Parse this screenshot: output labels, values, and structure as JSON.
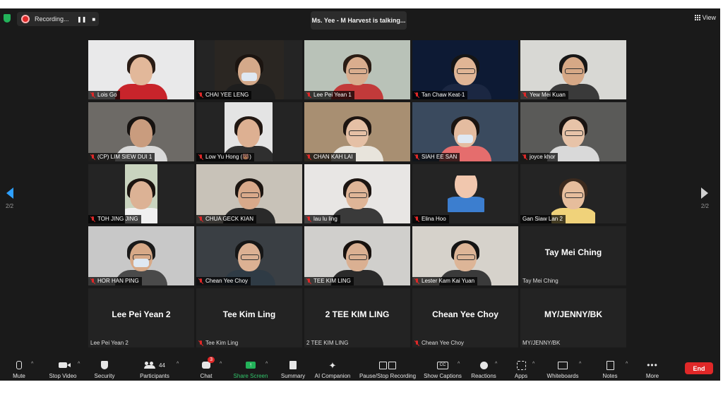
{
  "topbar": {
    "recording_label": "Recording...",
    "pause_icon": "pause-icon",
    "stop_icon": "stop-icon",
    "talking_text": "Ms. Yee - M Harvest is talking...",
    "view_label": "View"
  },
  "pager": {
    "left": "2/2",
    "right": "2/2"
  },
  "participants": [
    {
      "name": "Lois Go",
      "muted": true
    },
    {
      "name": "CHAI YEE LENG",
      "muted": true
    },
    {
      "name": "Lee Pei Yean 1",
      "muted": true
    },
    {
      "name": "Tan Chaw Keat-1",
      "muted": true
    },
    {
      "name": "Yew Mei Kuan",
      "muted": true
    },
    {
      "name": "(CP) LIM SIEW DUI 1",
      "muted": true
    },
    {
      "name": "Low Yu Hong (🐻)",
      "muted": true
    },
    {
      "name": "CHAN KAH LAI",
      "muted": true
    },
    {
      "name": "SIAH EE SAN",
      "muted": true
    },
    {
      "name": "joyce khor",
      "muted": true
    },
    {
      "name": "TOH JING JING",
      "muted": true
    },
    {
      "name": "CHUA GECK KIAN",
      "muted": true
    },
    {
      "name": "lau lu ling",
      "muted": true
    },
    {
      "name": "Elina Hoo",
      "muted": true
    },
    {
      "name": "Gan Siaw Lan 2",
      "muted": false
    },
    {
      "name": "HOR HAN PING",
      "muted": true
    },
    {
      "name": "Chean Yee Choy",
      "muted": true
    },
    {
      "name": "TEE KIM LING",
      "muted": true
    },
    {
      "name": "Lester Kam Kai Yuan",
      "muted": true
    },
    {
      "name": "Tay Mei Ching",
      "muted": false,
      "video_off": true,
      "big": "Tay Mei Ching"
    },
    {
      "name": "Lee Pei Yean 2",
      "muted": false,
      "video_off": true,
      "big": "Lee Pei Yean 2"
    },
    {
      "name": "Tee Kim Ling",
      "muted": true,
      "video_off": true,
      "big": "Tee Kim Ling"
    },
    {
      "name": "2 TEE KIM LING",
      "muted": false,
      "video_off": true,
      "big": "2 TEE KIM LING"
    },
    {
      "name": "Chean Yee Choy",
      "muted": true,
      "video_off": true,
      "big": "Chean Yee Choy"
    },
    {
      "name": "MY/JENNY/BK",
      "muted": false,
      "video_off": true,
      "big": "MY/JENNY/BK"
    }
  ],
  "toolbar": {
    "mute": "Mute",
    "stop_video": "Stop Video",
    "security": "Security",
    "participants": "Participants",
    "participants_count": "44",
    "chat": "Chat",
    "chat_badge": "3",
    "share_screen": "Share Screen",
    "summary": "Summary",
    "ai_companion": "AI Companion",
    "pause_stop_recording": "Pause/Stop Recording",
    "show_captions": "Show Captions",
    "reactions": "Reactions",
    "apps": "Apps",
    "whiteboards": "Whiteboards",
    "notes": "Notes",
    "more": "More",
    "end": "End",
    "caret": "^"
  },
  "colors": {
    "background": "#1a1a1a",
    "muted_red": "#e02828",
    "share_green": "#23b35a",
    "end_red": "#e02828",
    "nav_blue": "#2ea0ff"
  }
}
